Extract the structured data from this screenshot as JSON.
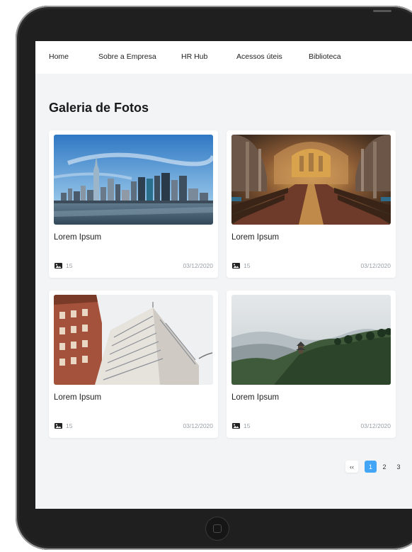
{
  "nav": {
    "items": [
      {
        "label": "Home"
      },
      {
        "label": "Sobre a Empresa"
      },
      {
        "label": "HR Hub"
      },
      {
        "label": "Acessos úteis"
      },
      {
        "label": "Biblioteca"
      }
    ]
  },
  "page": {
    "title": "Galeria de Fotos"
  },
  "gallery": {
    "cards": [
      {
        "title": "Lorem Ipsum",
        "photo_count": "15",
        "date": "03/12/2020",
        "image": "city-skyline"
      },
      {
        "title": "Lorem Ipsum",
        "photo_count": "15",
        "date": "03/12/2020",
        "image": "cathedral-interior"
      },
      {
        "title": "Lorem Ipsum",
        "photo_count": "15",
        "date": "03/12/2020",
        "image": "buildings"
      },
      {
        "title": "Lorem Ipsum",
        "photo_count": "15",
        "date": "03/12/2020",
        "image": "misty-mountains-pagoda"
      }
    ]
  },
  "pagination": {
    "prev_label": "‹‹",
    "pages": [
      "1",
      "2",
      "3"
    ],
    "current": "1"
  },
  "colors": {
    "accent": "#42a5f5",
    "background": "#f3f4f6",
    "card": "#ffffff",
    "muted_text": "#9aa0a6"
  }
}
